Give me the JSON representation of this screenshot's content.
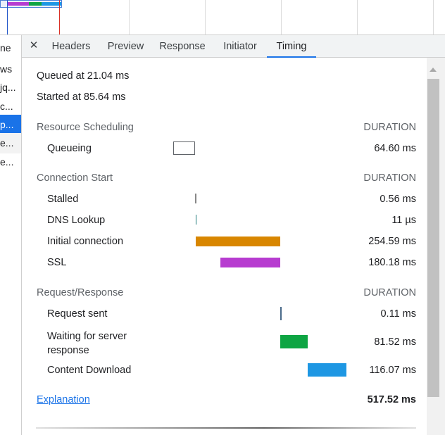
{
  "request_list": {
    "items": [
      {
        "label": "ne",
        "state": "normal"
      },
      {
        "label": "ws",
        "state": "normal"
      },
      {
        "label": "jq...",
        "state": "normal"
      },
      {
        "label": "c...",
        "state": "normal"
      },
      {
        "label": "p...",
        "state": "selected"
      },
      {
        "label": "e...",
        "state": "alt"
      },
      {
        "label": "e...",
        "state": "normal"
      }
    ]
  },
  "tabs": {
    "close_glyph": "✕",
    "items": [
      {
        "label": "Headers"
      },
      {
        "label": "Preview"
      },
      {
        "label": "Response"
      },
      {
        "label": "Initiator"
      },
      {
        "label": "Timing",
        "active": true
      }
    ]
  },
  "timing": {
    "queued_at": "Queued at 21.04 ms",
    "started_at": "Started at 85.64 ms",
    "sections": [
      {
        "title": "Resource Scheduling",
        "duration_label": "DURATION",
        "rows": [
          {
            "label": "Queueing",
            "value": "64.60 ms",
            "start_ms": 21.04,
            "dur_ms": 64.6,
            "style": "box"
          }
        ]
      },
      {
        "title": "Connection Start",
        "duration_label": "DURATION",
        "rows": [
          {
            "label": "Stalled",
            "value": "0.56 ms",
            "start_ms": 85.64,
            "dur_ms": 0.56,
            "style": "tick",
            "color": "#888888"
          },
          {
            "label": "DNS Lookup",
            "value": "11 µs",
            "start_ms": 86.2,
            "dur_ms": 0.011,
            "style": "tick",
            "color": "#1f7a7a"
          },
          {
            "label": "Initial connection",
            "value": "254.59 ms",
            "start_ms": 86.21,
            "dur_ms": 254.59,
            "style": "bar",
            "color": "#d88600"
          },
          {
            "label": "SSL",
            "value": "180.18 ms",
            "start_ms": 160.62,
            "dur_ms": 180.18,
            "style": "bar",
            "color": "#b73cd0"
          }
        ]
      },
      {
        "title": "Request/Response",
        "duration_label": "DURATION",
        "rows": [
          {
            "label": "Request sent",
            "value": "0.11 ms",
            "start_ms": 340.8,
            "dur_ms": 0.11,
            "style": "tick",
            "color": "#4a6a8a"
          },
          {
            "label": "Waiting for server response",
            "value": "81.52 ms",
            "start_ms": 340.91,
            "dur_ms": 81.52,
            "style": "bar",
            "color": "#0ea543"
          },
          {
            "label": "Content Download",
            "value": "116.07 ms",
            "start_ms": 422.43,
            "dur_ms": 116.07,
            "style": "bar",
            "color": "#1e97e3"
          }
        ]
      }
    ],
    "explanation_label": "Explanation",
    "total": "517.52 ms"
  },
  "colors": {
    "accent": "#1a73e8",
    "overview_segments": [
      "#b73cd0",
      "#0ea543",
      "#1e97e3"
    ],
    "overview_markers": [
      "#2156c9",
      "#d93025"
    ]
  }
}
